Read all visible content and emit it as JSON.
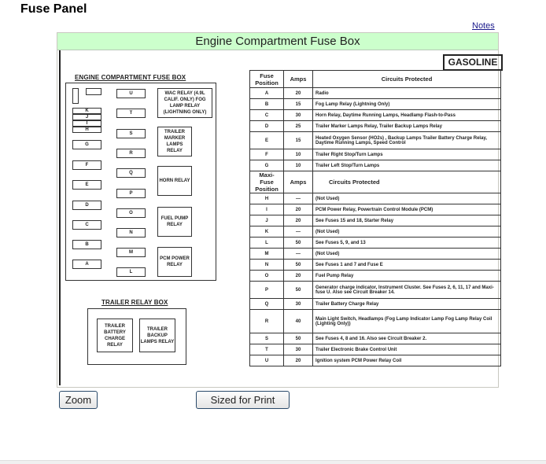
{
  "page": {
    "title": "Fuse Panel",
    "notes_link": "Notes"
  },
  "frame": {
    "header": "Engine Compartment Fuse Box",
    "header_color": "#ccffcc"
  },
  "diagram": {
    "engine_box_title": "ENGINE COMPARTMENT FUSE BOX",
    "left_column": [
      "K",
      "J",
      "I",
      "H",
      "G",
      "F",
      "E",
      "D",
      "C",
      "B",
      "A"
    ],
    "middle_column": [
      "U",
      "T",
      "S",
      "R",
      "Q",
      "P",
      "O",
      "N",
      "M",
      "L"
    ],
    "relays": [
      "WAC RELAY (4.9L CALIF. ONLY) FOG LAMP RELAY (LIGHTNING ONLY)",
      "TRAILER MARKER LAMPS RELAY",
      "HORN RELAY",
      "FUEL PUMP RELAY",
      "PCM POWER RELAY"
    ],
    "trailer_box_title": "TRAILER RELAY BOX",
    "trailer_relays": [
      "TRAILER BATTERY CHARGE RELAY",
      "TRAILER BACKUP LAMPS RELAY"
    ]
  },
  "badge": "GASOLINE",
  "fuse_table": {
    "headers": {
      "position": "Fuse Position",
      "amps": "Amps",
      "circuits": "Circuits Protected"
    },
    "rows": [
      {
        "pos": "A",
        "amps": "20",
        "circuits": "Radio"
      },
      {
        "pos": "B",
        "amps": "15",
        "circuits": "Fog Lamp Relay (Lightning Only)"
      },
      {
        "pos": "C",
        "amps": "30",
        "circuits": "Horn Relay, Daytime Running Lamps, Headlamp Flash-to-Pass"
      },
      {
        "pos": "D",
        "amps": "25",
        "circuits": "Trailer Marker Lamps Relay, Trailer Backup Lamps Relay"
      },
      {
        "pos": "E",
        "amps": "15",
        "circuits": "Heated Oxygen Sensor (HO2s) , Backup Lamps Trailer Battery Charge Relay, Daytime Running Lamps, Speed Control"
      },
      {
        "pos": "F",
        "amps": "10",
        "circuits": "Trailer Right Stop/Turn Lamps"
      },
      {
        "pos": "G",
        "amps": "10",
        "circuits": "Trailer Left Stop/Turn Lamps"
      }
    ]
  },
  "maxi_table": {
    "headers": {
      "position": "Maxi-Fuse Position",
      "amps": "Amps",
      "circuits": "Circuits Protected"
    },
    "rows": [
      {
        "pos": "H",
        "amps": "—",
        "circuits": "(Not Used)"
      },
      {
        "pos": "I",
        "amps": "20",
        "circuits": "PCM Power Relay, Powertrain Control Module (PCM)"
      },
      {
        "pos": "J",
        "amps": "20",
        "circuits": "See Fuses 15 and 18, Starter Relay"
      },
      {
        "pos": "K",
        "amps": "—",
        "circuits": "(Not Used)"
      },
      {
        "pos": "L",
        "amps": "50",
        "circuits": "See Fuses 5, 9, and 13"
      },
      {
        "pos": "M",
        "amps": "—",
        "circuits": "(Not Used)"
      },
      {
        "pos": "N",
        "amps": "50",
        "circuits": "See Fuses 1 and 7 and Fuse E"
      },
      {
        "pos": "O",
        "amps": "20",
        "circuits": "Fuel Pump Relay"
      },
      {
        "pos": "P",
        "amps": "50",
        "circuits": "Generator charge indicator, Instrument Cluster. See Fuses 2, 6, 11, 17 and Maxi-fuse U. Also see Circuit Breaker 14."
      },
      {
        "pos": "Q",
        "amps": "30",
        "circuits": "Trailer Battery Charge Relay"
      },
      {
        "pos": "R",
        "amps": "40",
        "circuits": "Main Light Switch, Headlamps (Fog Lamp Indicator Lamp Fog Lamp Relay Coil (Lighting Only))"
      },
      {
        "pos": "S",
        "amps": "50",
        "circuits": "See Fuses 4, 8 and 16. Also see Circuit Breaker 2."
      },
      {
        "pos": "T",
        "amps": "30",
        "circuits": "Trailer Electronic Brake Control Unit"
      },
      {
        "pos": "U",
        "amps": "20",
        "circuits": "Ignition system PCM Power Relay Coil"
      }
    ]
  },
  "buttons": {
    "zoom": "Zoom",
    "print": "Sized for Print"
  }
}
